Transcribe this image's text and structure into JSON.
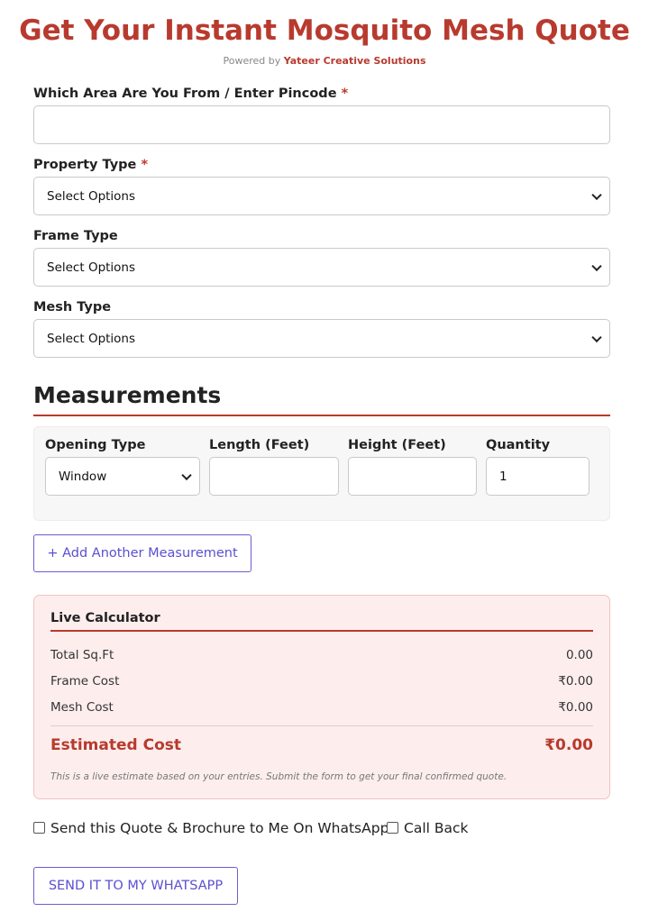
{
  "header": {
    "title": "Get Your Instant Mosquito Mesh Quote",
    "powered_prefix": "Powered by",
    "powered_brand": "Yateer Creative Solutions"
  },
  "form": {
    "area": {
      "label": "Which Area Are You From / Enter Pincode",
      "required_mark": "*",
      "value": ""
    },
    "property_type": {
      "label": "Property Type",
      "required_mark": "*",
      "selected": "Select Options"
    },
    "frame_type": {
      "label": "Frame Type",
      "selected": "Select Options"
    },
    "mesh_type": {
      "label": "Mesh Type",
      "selected": "Select Options"
    }
  },
  "measurements": {
    "title": "Measurements",
    "columns": {
      "opening_type": "Opening Type",
      "length": "Length (Feet)",
      "height": "Height (Feet)",
      "quantity": "Quantity"
    },
    "row": {
      "opening_type": "Window",
      "length": "",
      "height": "",
      "quantity": "1"
    },
    "add_button": "+ Add Another Measurement"
  },
  "calculator": {
    "title": "Live Calculator",
    "rows": [
      {
        "label": "Total Sq.Ft",
        "value": "0.00"
      },
      {
        "label": "Frame Cost",
        "value": "₹0.00"
      },
      {
        "label": "Mesh Cost",
        "value": "₹0.00"
      }
    ],
    "total_label": "Estimated Cost",
    "total_value": "₹0.00",
    "note": "This is a live estimate based on your entries. Submit the form to get your final confirmed quote."
  },
  "options": {
    "whatsapp_label": "Send this Quote & Brochure to Me On WhatsApp",
    "whatsapp_checked": false,
    "callback_label": "Call Back",
    "callback_checked": false
  },
  "submit_label": "SEND IT TO MY WHATSAPP",
  "colors": {
    "accent": "#b83a2e",
    "button": "#5b4fd0",
    "calc_bg": "#fdeeed"
  }
}
